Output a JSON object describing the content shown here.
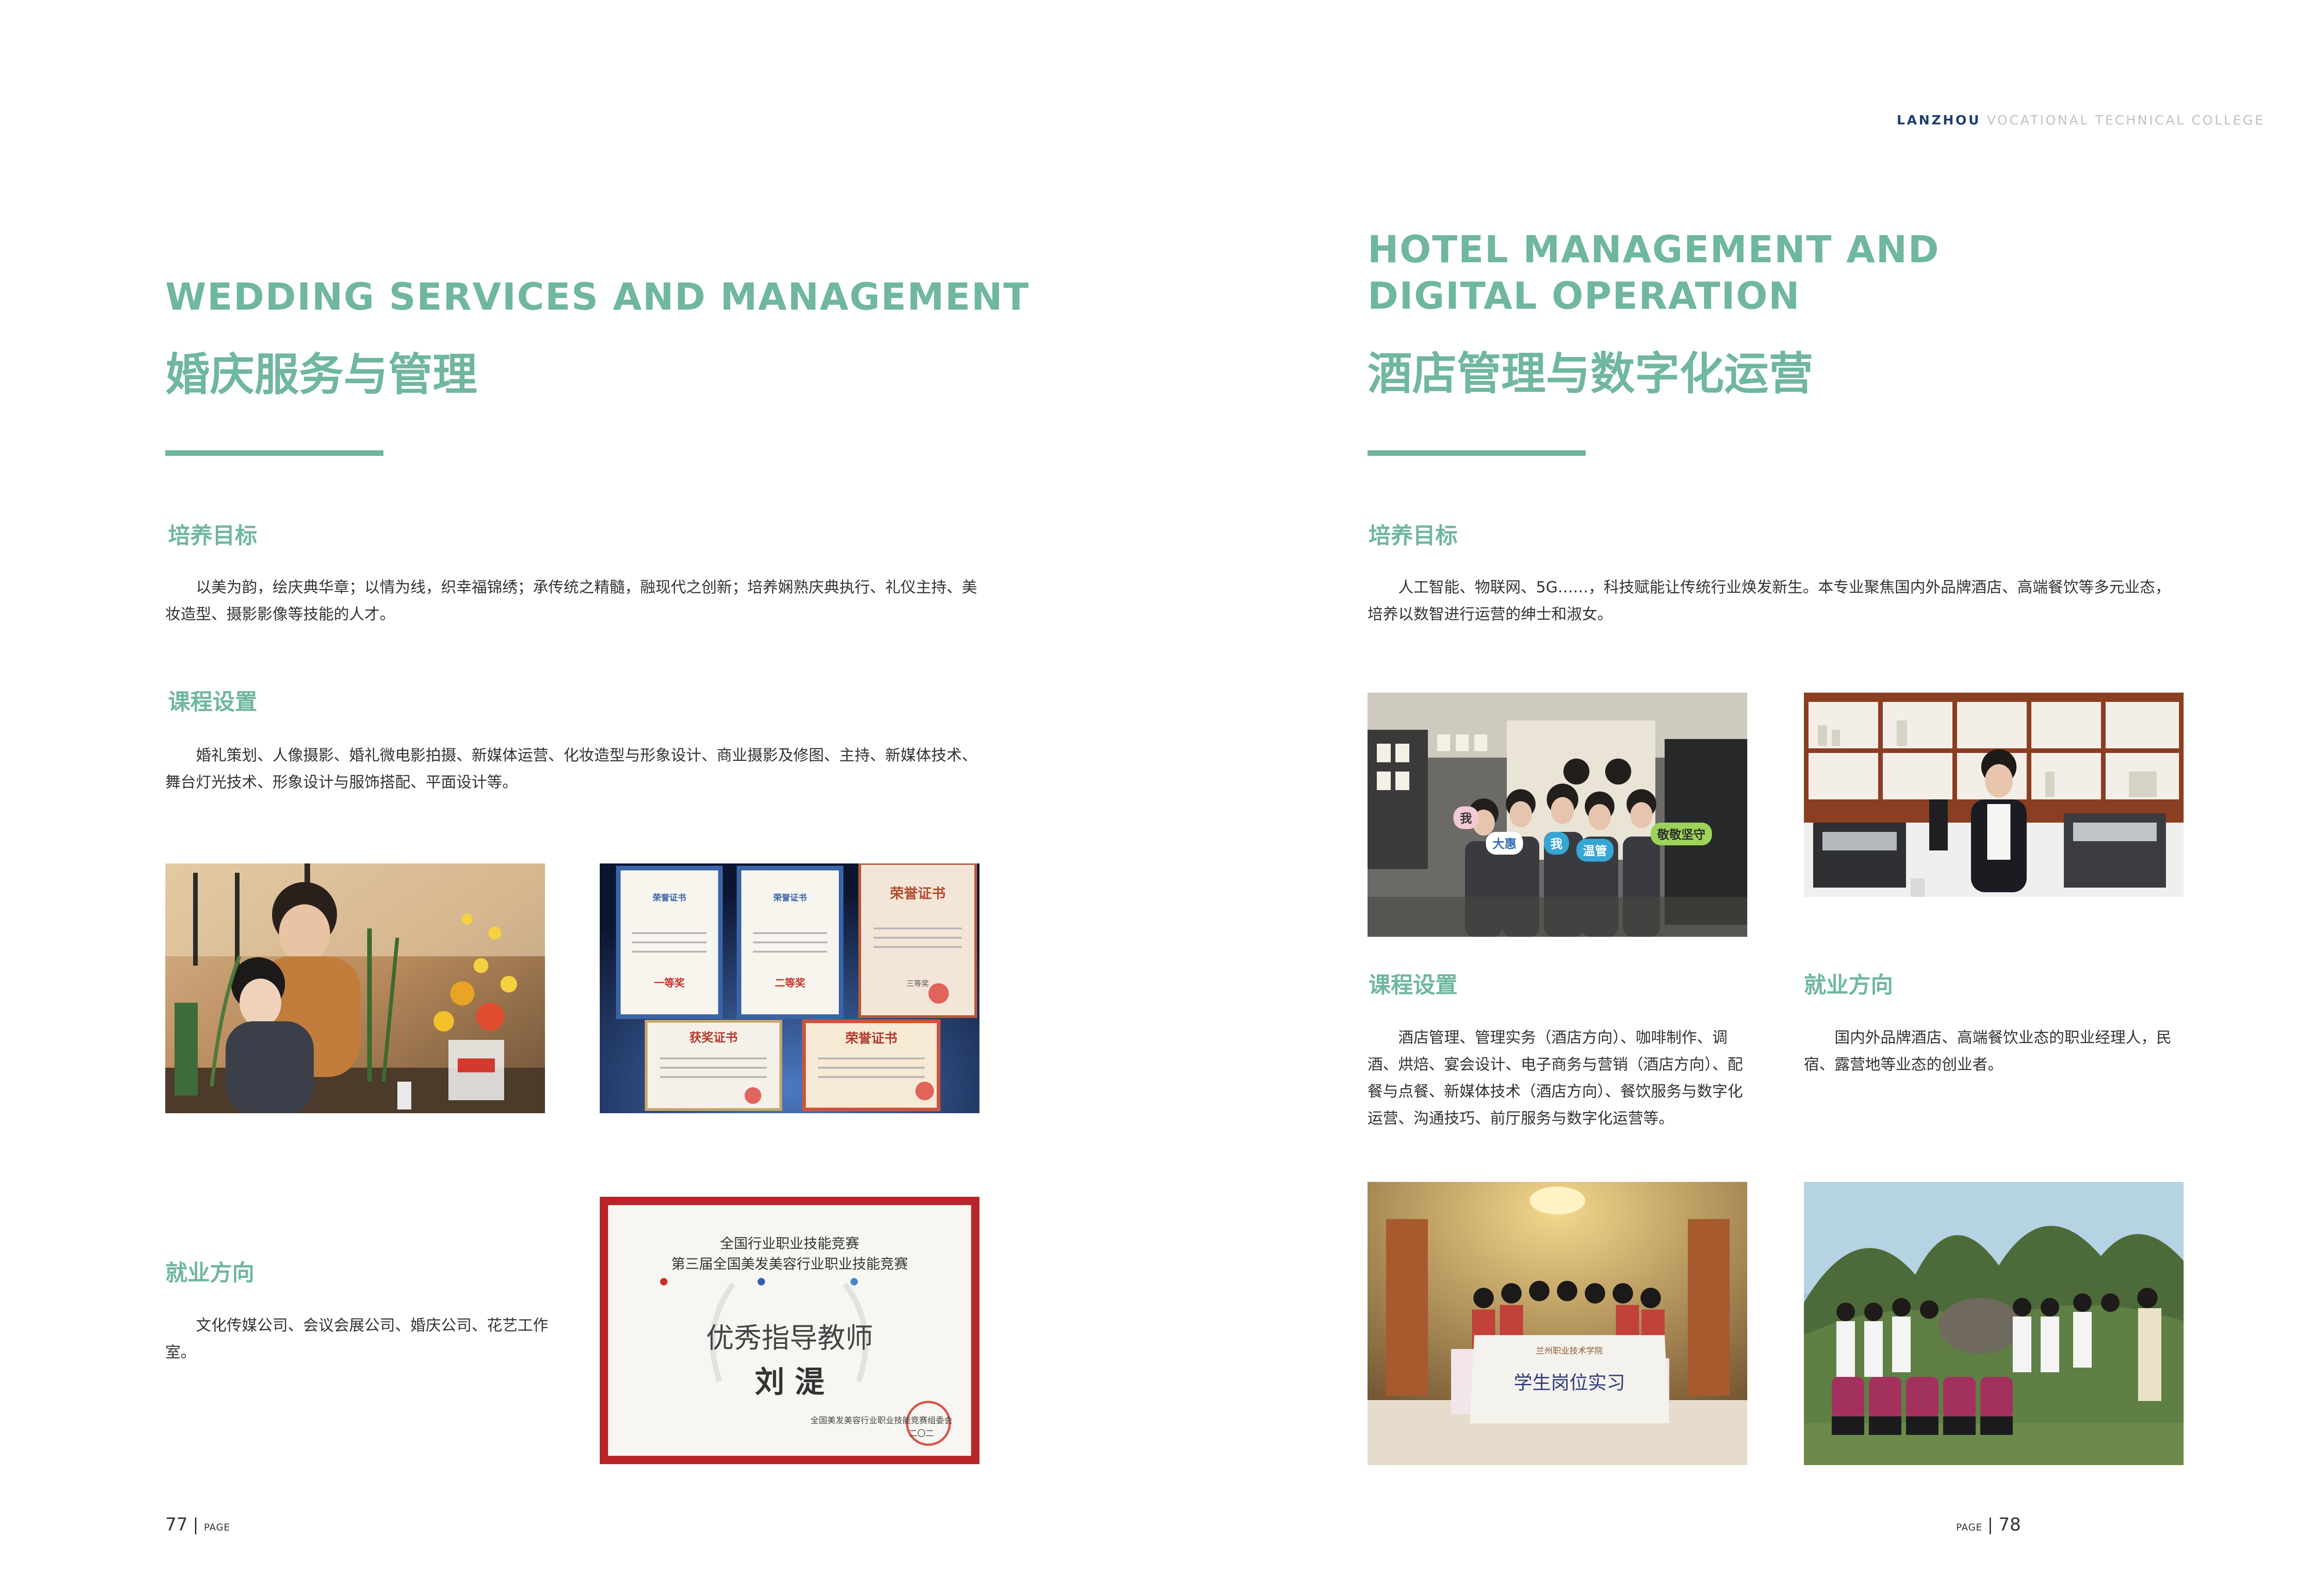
{
  "header": {
    "brand_bold": "LANZHOU",
    "brand_light": "VOCATIONAL TECHNICAL COLLEGE"
  },
  "left": {
    "title_en": "WEDDING SERVICES AND MANAGEMENT",
    "title_cn": "婚庆服务与管理",
    "goal_heading": "培养目标",
    "goal_text": "以美为韵，绘庆典华章；以情为线，织幸福锦绣；承传统之精髓，融现代之创新；培养娴熟庆典执行、礼仪主持、美妆造型、摄影影像等技能的人才。",
    "course_heading": "课程设置",
    "course_text": "婚礼策划、人像摄影、婚礼微电影拍摄、新媒体运营、化妆造型与形象设计、商业摄影及修图、主持、新媒体技术、舞台灯光技术、形象设计与服饰搭配、平面设计等。",
    "career_heading": "就业方向",
    "career_text": "文化传媒公司、会议会展公司、婚庆公司、花艺工作室。",
    "cert": {
      "top_line1": "全国行业职业技能竞赛",
      "top_line2": "第三届全国美发美容行业职业技能竞赛",
      "award": "优秀指导教师",
      "name": "刘 湜",
      "issuer": "全国美发美容行业职业技能竞赛组委会",
      "year": "二〇二"
    },
    "honors": {
      "c1_title": "荣誉证书",
      "c1_rank": "一等奖",
      "c2_title": "荣誉证书",
      "c2_rank": "二等奖",
      "c3_title": "荣誉证书",
      "c3_rank": "三等奖",
      "c4_title": "获奖证书",
      "c5_title": "荣誉证书"
    },
    "page_number": "77",
    "page_label": "PAGE"
  },
  "right": {
    "title_en_line1": "HOTEL MANAGEMENT AND",
    "title_en_line2": "DIGITAL OPERATION",
    "title_cn": "酒店管理与数字化运营",
    "goal_heading": "培养目标",
    "goal_text": "人工智能、物联网、5G……，科技赋能让传统行业焕发新生。本专业聚焦国内外品牌酒店、高端餐饮等多元业态，培养以数智进行运营的绅士和淑女。",
    "course_heading": "课程设置",
    "course_text": "酒店管理、管理实务（酒店方向）、咖啡制作、调酒、烘焙、宴会设计、电子商务与营销（酒店方向）、配餐与点餐、新媒体技术（酒店方向）、餐饮服务与数字化运营、沟通技巧、前厅服务与数字化运营等。",
    "career_heading": "就业方向",
    "career_text": "国内外品牌酒店、高端餐饮业态的职业经理人，民宿、露营地等业态的创业者。",
    "photo1_signs": [
      "我",
      "大惠",
      "我",
      "温管",
      "敬敬坚守"
    ],
    "photo3_banner_school": "兰州职业技术学院",
    "photo3_banner_text": "学生岗位实习",
    "page_number": "78",
    "page_label": "PAGE"
  },
  "colors": {
    "accent": "#6fb79d",
    "brand_dark": "#1f3f73",
    "cert_frame": "#b8262a"
  }
}
